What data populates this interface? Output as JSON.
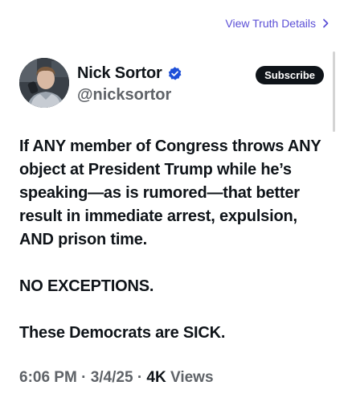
{
  "header_link": {
    "label": "View Truth Details"
  },
  "post": {
    "display_name": "Nick Sortor",
    "handle": "@nicksortor",
    "subscribe_label": "Subscribe",
    "paragraphs": [
      "If ANY member of Congress throws ANY object at President Trump while he’s speaking—as is rumored—that better result in immediate arrest, expulsion, AND prison time.",
      "NO EXCEPTIONS.",
      "These Democrats are SICK."
    ],
    "time": "6:06 PM",
    "date": "3/4/25",
    "views_count": "4K",
    "views_label": "Views",
    "separator": "·"
  },
  "colors": {
    "link": "#5b4fd6",
    "verified": "#1d4fd8",
    "subscribe_bg": "#0f1419",
    "muted": "#5f6368"
  },
  "icons": {
    "chevron": "chevron-right-icon",
    "verified": "verified-badge-icon"
  }
}
